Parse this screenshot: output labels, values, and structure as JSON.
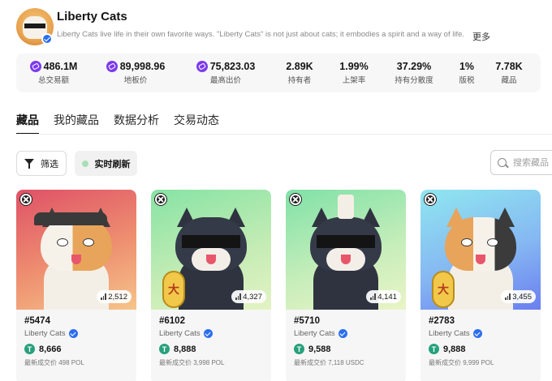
{
  "collection": {
    "name": "Liberty Cats",
    "description": "Liberty Cats live life in their own favorite ways. \"Liberty Cats\" is not just about cats; it embodies a spirit and a way of life.",
    "more_label": "更多"
  },
  "stats": [
    {
      "value": "486.1M",
      "label": "总交易额",
      "icon": "polygon-icon"
    },
    {
      "value": "89,998.96",
      "label": "地板价",
      "icon": "polygon-icon"
    },
    {
      "value": "75,823.03",
      "label": "最高出价",
      "icon": "polygon-icon"
    },
    {
      "value": "2.89K",
      "label": "持有者"
    },
    {
      "value": "1.99%",
      "label": "上架率"
    },
    {
      "value": "37.29%",
      "label": "持有分散度"
    },
    {
      "value": "1%",
      "label": "版税"
    },
    {
      "value": "7.78K",
      "label": "藏品"
    }
  ],
  "tabs": [
    "藏品",
    "我的藏品",
    "数据分析",
    "交易动态"
  ],
  "toolbar": {
    "filter_label": "筛选",
    "live_label": "实时刷新",
    "search_placeholder": "搜索藏品"
  },
  "cards": [
    {
      "token": "#5474",
      "collection": "Liberty Cats",
      "rarity": "2,512",
      "price": "8,666",
      "last_sale": "最新成交价 498 POL",
      "bg": [
        "#e0566a",
        "#f3b779"
      ]
    },
    {
      "token": "#6102",
      "collection": "Liberty Cats",
      "rarity": "4,327",
      "price": "8,888",
      "last_sale": "最新成交价 3,998 POL",
      "bg": [
        "#86e3a4",
        "#d6f0c2"
      ]
    },
    {
      "token": "#5710",
      "collection": "Liberty Cats",
      "rarity": "4,141",
      "price": "9,588",
      "last_sale": "最新成交价 7,118 USDC",
      "bg": [
        "#7fe1a7",
        "#eaf4c6"
      ]
    },
    {
      "token": "#2783",
      "collection": "Liberty Cats",
      "rarity": "3,455",
      "price": "9,888",
      "last_sale": "最新成交价 9,999 POL",
      "bg": [
        "#8fe7f0",
        "#6a8ef2"
      ]
    }
  ],
  "colors": {
    "accent": "#7c3aed",
    "verified": "#2b6fef",
    "tether": "#26a17b"
  }
}
